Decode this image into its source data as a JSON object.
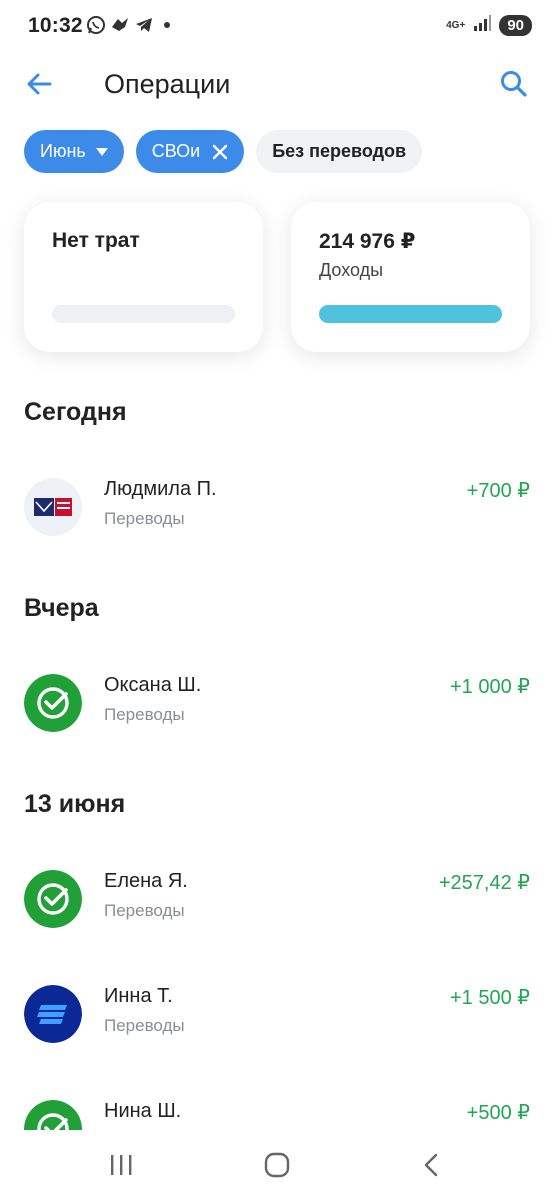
{
  "status_bar": {
    "time": "10:32",
    "network": "4G+",
    "battery": "90",
    "icons": [
      "whatsapp-icon",
      "bird-app-icon",
      "telegram-icon",
      "notification-dot-icon",
      "signal-icon",
      "battery-icon"
    ]
  },
  "appbar": {
    "title": "Операции",
    "back_icon": "arrow-left-icon",
    "search_icon": "search-icon"
  },
  "chips": [
    {
      "label": "Июнь",
      "icon": "chevron-down-icon",
      "active": true
    },
    {
      "label": "СВОи",
      "icon": "close-icon",
      "active": true
    },
    {
      "label": "Без переводов",
      "active": false
    }
  ],
  "summary": {
    "spend": {
      "title": "Нет трат",
      "progress": 0
    },
    "income": {
      "amount": "214 976 ₽",
      "label": "Доходы",
      "progress": 1.0
    }
  },
  "sections": [
    {
      "title": "Сегодня",
      "items": [
        {
          "name": "Людмила П.",
          "category": "Переводы",
          "amount": "+700 ₽",
          "bank_icon": "pochta-bank-icon"
        }
      ]
    },
    {
      "title": "Вчера",
      "items": [
        {
          "name": "Оксана Ш.",
          "category": "Переводы",
          "amount": "+1 000 ₽",
          "bank_icon": "sber-icon"
        }
      ]
    },
    {
      "title": "13 июня",
      "items": [
        {
          "name": "Елена Я.",
          "category": "Переводы",
          "amount": "+257,42 ₽",
          "bank_icon": "sber-icon"
        },
        {
          "name": "Инна Т.",
          "category": "Переводы",
          "amount": "+1 500 ₽",
          "bank_icon": "vtb-icon"
        },
        {
          "name": "Нина Ш.",
          "category": "",
          "amount": "+500 ₽",
          "bank_icon": "sber-icon"
        }
      ]
    }
  ],
  "colors": {
    "accent": "#3d8be8",
    "income": "#22a653",
    "progress": "#4fc3dd",
    "sber": "#21a038",
    "vtb": "#0a2896",
    "pochta": "#1e2a6e"
  },
  "system_nav": [
    "recent-apps-icon",
    "home-icon",
    "back-icon"
  ]
}
